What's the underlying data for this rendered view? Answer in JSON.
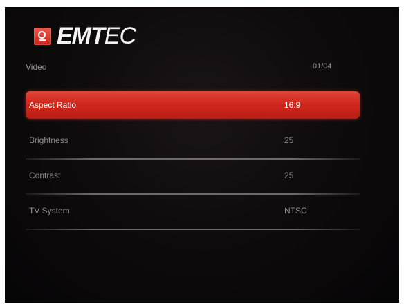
{
  "brand": {
    "bold": "EMT",
    "light": "EC"
  },
  "section": {
    "title": "Video",
    "page": "01/04"
  },
  "menu": {
    "items": [
      {
        "label": "Aspect Ratio",
        "value": "16:9"
      },
      {
        "label": "Brightness",
        "value": "25"
      },
      {
        "label": "Contrast",
        "value": "25"
      },
      {
        "label": "TV System",
        "value": "NTSC"
      }
    ],
    "selected_index": 0
  },
  "colors": {
    "highlight": "#d22a1e",
    "background": "#0d0a0b",
    "text_dim": "#8e8c8d",
    "text_selected": "#ffffff"
  }
}
